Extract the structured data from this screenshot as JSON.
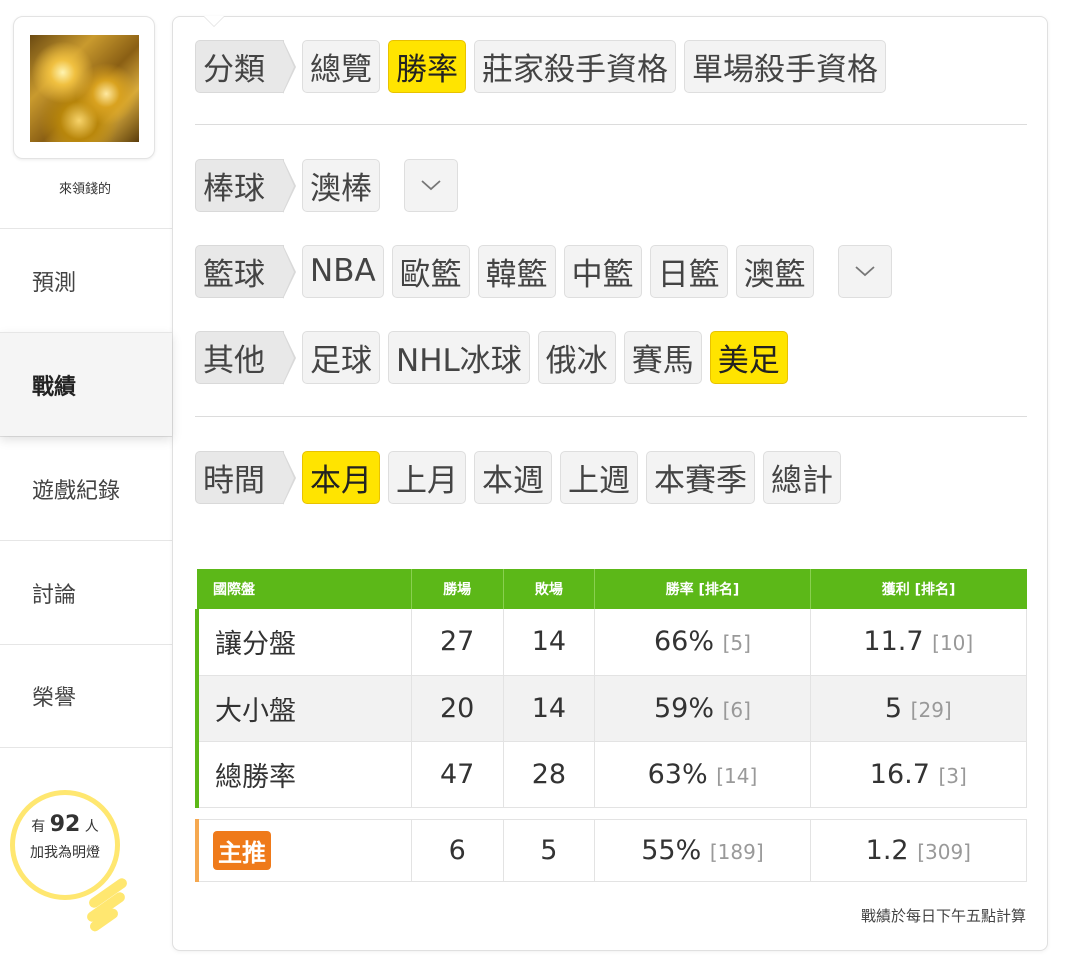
{
  "user": {
    "name": "來領錢的"
  },
  "nav": [
    {
      "label": "預測"
    },
    {
      "label": "戰績"
    },
    {
      "label": "遊戲紀錄"
    },
    {
      "label": "討論"
    },
    {
      "label": "榮譽"
    }
  ],
  "fans": {
    "prefix": "有",
    "count": "92",
    "suffix": "人",
    "line2": "加我為明燈"
  },
  "filters": {
    "category": {
      "label": "分類",
      "options": [
        "總覽",
        "勝率",
        "莊家殺手資格",
        "單場殺手資格"
      ],
      "selected": "勝率"
    },
    "baseball": {
      "label": "棒球",
      "options": [
        "澳棒"
      ]
    },
    "basketball": {
      "label": "籃球",
      "options": [
        "NBA",
        "歐籃",
        "韓籃",
        "中籃",
        "日籃",
        "澳籃"
      ]
    },
    "other": {
      "label": "其他",
      "options": [
        "足球",
        "NHL冰球",
        "俄冰",
        "賽馬",
        "美足"
      ],
      "selected": "美足"
    },
    "time": {
      "label": "時間",
      "options": [
        "本月",
        "上月",
        "本週",
        "上週",
        "本賽季",
        "總計"
      ],
      "selected": "本月"
    }
  },
  "table": {
    "headers": [
      "國際盤",
      "勝場",
      "敗場",
      "勝率 [排名]",
      "獲利 [排名]"
    ],
    "rows": [
      {
        "name": "讓分盤",
        "win": "27",
        "loss": "14",
        "rate": "66%",
        "rate_rank": "[5]",
        "profit": "11.7",
        "profit_rank": "[10]"
      },
      {
        "name": "大小盤",
        "win": "20",
        "loss": "14",
        "rate": "59%",
        "rate_rank": "[6]",
        "profit": "5",
        "profit_rank": "[29]"
      },
      {
        "name": "總勝率",
        "win": "47",
        "loss": "28",
        "rate": "63%",
        "rate_rank": "[14]",
        "profit": "16.7",
        "profit_rank": "[3]"
      }
    ],
    "main_pick": {
      "badge": "主推",
      "win": "6",
      "loss": "5",
      "rate": "55%",
      "rate_rank": "[189]",
      "profit": "1.2",
      "profit_rank": "[309]"
    }
  },
  "footnote": "戰績於每日下午五點計算",
  "colors": {
    "selected": "#ffe400",
    "header_green": "#5cb818",
    "badge_orange": "#ef7a1a",
    "bulb_yellow": "#ffe770"
  }
}
